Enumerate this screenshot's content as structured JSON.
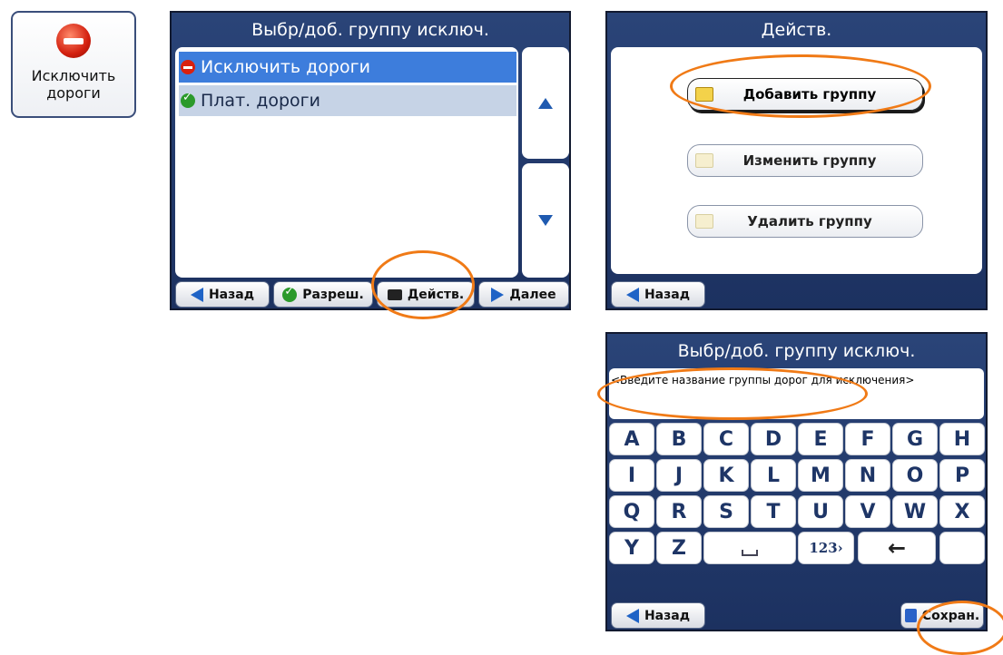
{
  "exclude_button": {
    "label_line1": "Исключить",
    "label_line2": "дороги",
    "icon": "stop-icon"
  },
  "screen1": {
    "title": "Выбр/доб. группу исключ.",
    "rows": [
      {
        "label": "Исключить дороги",
        "icon": "stop-icon",
        "selected": true
      },
      {
        "label": "Плат. дороги",
        "icon": "check-icon",
        "selected": false
      }
    ],
    "footer": {
      "back": "Назад",
      "allow": "Разреш.",
      "actions": "Действ.",
      "next": "Далее"
    }
  },
  "screen2": {
    "title": "Действ.",
    "buttons": [
      "Добавить группу",
      "Изменить группу",
      "Удалить группу"
    ],
    "footer": {
      "back": "Назад"
    }
  },
  "screen3": {
    "title": "Выбр/доб. группу исключ.",
    "input_placeholder": "<Введите название группы дорог для исключения>",
    "keys_row1": [
      "A",
      "B",
      "C",
      "D",
      "E",
      "F",
      "G",
      "H"
    ],
    "keys_row2": [
      "I",
      "J",
      "K",
      "L",
      "M",
      "N",
      "O",
      "P"
    ],
    "keys_row3": [
      "Q",
      "R",
      "S",
      "T",
      "U",
      "V",
      "W",
      "X"
    ],
    "keys_row4": [
      "Y",
      "Z"
    ],
    "numbers_key": "123›",
    "backspace_key": "←",
    "footer": {
      "back": "Назад",
      "save": "Сохран."
    }
  },
  "colors": {
    "accent": "#f07a16",
    "title_bar": "#2a4478",
    "selected_row": "#3d7ddc",
    "row2_bg": "#c6d3e6"
  }
}
